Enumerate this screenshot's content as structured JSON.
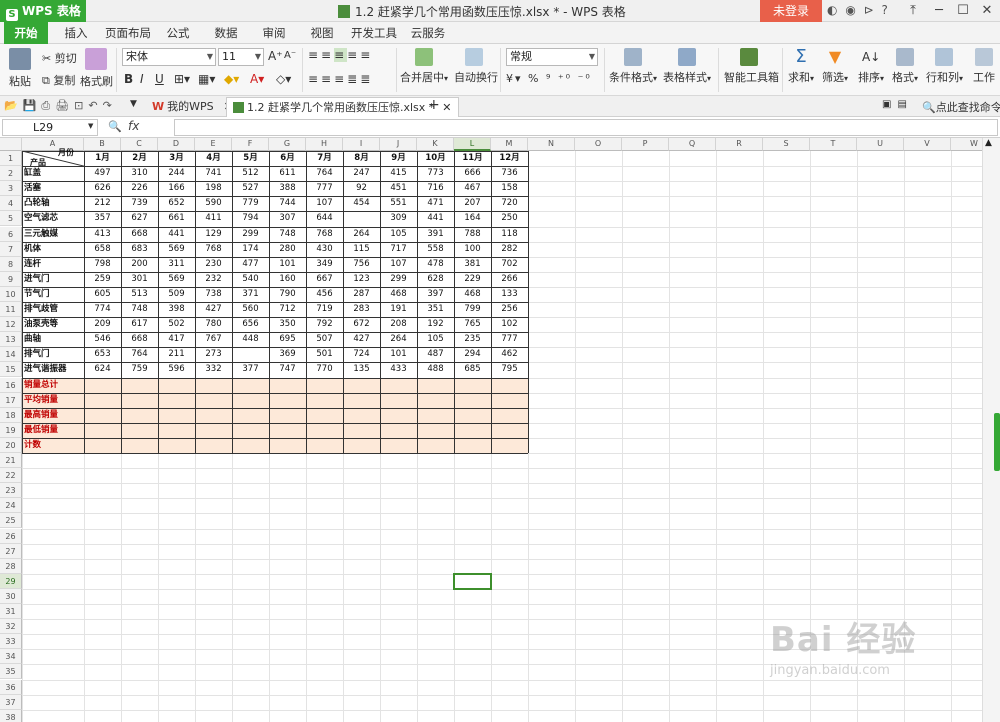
{
  "app": {
    "name": "WPS 表格",
    "doc_title": "1.2 赶紧学几个常用函数压压惊.xlsx * - WPS 表格",
    "login": "未登录"
  },
  "tabs": [
    "开始",
    "插入",
    "页面布局",
    "公式",
    "数据",
    "审阅",
    "视图",
    "开发工具",
    "云服务"
  ],
  "ribbon": {
    "paste": "粘贴",
    "cut": "剪切",
    "copy": "复制",
    "format_painter": "格式刷",
    "font_name": "宋体",
    "font_size": "11",
    "merge_center": "合并居中",
    "wrap_text": "自动换行",
    "number_format": "常规",
    "conditional_format": "条件格式",
    "table_style": "表格样式",
    "smart_toolbox": "智能工具箱",
    "sum": "求和",
    "filter": "筛选",
    "sort": "排序",
    "format": "格式",
    "row_col": "行和列",
    "worksheet": "工作"
  },
  "doc_tabs": {
    "home": "我的WPS",
    "file": "1.2 赶紧学几个常用函数压压惊.xlsx *",
    "search": "点此查找命令"
  },
  "formula_bar": {
    "cell_ref": "L29",
    "fx": "fx",
    "content": ""
  },
  "sheet": {
    "columns": [
      "A",
      "B",
      "C",
      "D",
      "E",
      "F",
      "G",
      "H",
      "I",
      "J",
      "K",
      "L",
      "M",
      "N",
      "O",
      "P",
      "Q",
      "R",
      "S",
      "T",
      "U",
      "V",
      "W"
    ],
    "selected_column": "L",
    "selected_row": 29,
    "header_corner_top": "月份",
    "header_corner_bottom": "产品",
    "months": [
      "1月",
      "2月",
      "3月",
      "4月",
      "5月",
      "6月",
      "7月",
      "8月",
      "9月",
      "10月",
      "11月",
      "12月"
    ],
    "products": [
      {
        "name": "缸盖",
        "values": [
          "497",
          "310",
          "244",
          "741",
          "512",
          "611",
          "764",
          "247",
          "415",
          "773",
          "666",
          "736"
        ]
      },
      {
        "name": "活塞",
        "values": [
          "626",
          "226",
          "166",
          "198",
          "527",
          "388",
          "777",
          "92",
          "451",
          "716",
          "467",
          "158"
        ]
      },
      {
        "name": "凸轮轴",
        "values": [
          "212",
          "739",
          "652",
          "590",
          "779",
          "744",
          "107",
          "454",
          "551",
          "471",
          "207",
          "720"
        ]
      },
      {
        "name": "空气滤芯",
        "values": [
          "357",
          "627",
          "661",
          "411",
          "794",
          "307",
          "644",
          "",
          "309",
          "441",
          "164",
          "250"
        ]
      },
      {
        "name": "三元触媒",
        "values": [
          "413",
          "668",
          "441",
          "129",
          "299",
          "748",
          "768",
          "264",
          "105",
          "391",
          "788",
          "118"
        ]
      },
      {
        "name": "机体",
        "values": [
          "658",
          "683",
          "569",
          "768",
          "174",
          "280",
          "430",
          "115",
          "717",
          "558",
          "100",
          "282"
        ]
      },
      {
        "name": "连杆",
        "values": [
          "798",
          "200",
          "311",
          "230",
          "477",
          "101",
          "349",
          "756",
          "107",
          "478",
          "381",
          "702"
        ]
      },
      {
        "name": "进气门",
        "values": [
          "259",
          "301",
          "569",
          "232",
          "540",
          "160",
          "667",
          "123",
          "299",
          "628",
          "229",
          "266"
        ]
      },
      {
        "name": "节气门",
        "values": [
          "605",
          "513",
          "509",
          "738",
          "371",
          "790",
          "456",
          "287",
          "468",
          "397",
          "468",
          "133"
        ]
      },
      {
        "name": "排气歧管",
        "values": [
          "774",
          "748",
          "398",
          "427",
          "560",
          "712",
          "719",
          "283",
          "191",
          "351",
          "799",
          "256"
        ]
      },
      {
        "name": "油泵壳等",
        "values": [
          "209",
          "617",
          "502",
          "780",
          "656",
          "350",
          "792",
          "672",
          "208",
          "192",
          "765",
          "102"
        ]
      },
      {
        "name": "曲轴",
        "values": [
          "546",
          "668",
          "417",
          "767",
          "448",
          "695",
          "507",
          "427",
          "264",
          "105",
          "235",
          "777"
        ]
      },
      {
        "name": "排气门",
        "values": [
          "653",
          "764",
          "211",
          "273",
          "",
          "369",
          "501",
          "724",
          "101",
          "487",
          "294",
          "462"
        ]
      },
      {
        "name": "进气谐振器",
        "values": [
          "624",
          "759",
          "596",
          "332",
          "377",
          "747",
          "770",
          "135",
          "433",
          "488",
          "685",
          "795"
        ]
      }
    ],
    "summary_rows": [
      "销量总计",
      "平均销量",
      "最高销量",
      "最低销量",
      "计数"
    ],
    "summary_color": "#fde9d9",
    "summary_text_color": "#c00000"
  },
  "watermark": {
    "line1": "Bai 经验",
    "line2": "jingyan.baidu.com"
  }
}
